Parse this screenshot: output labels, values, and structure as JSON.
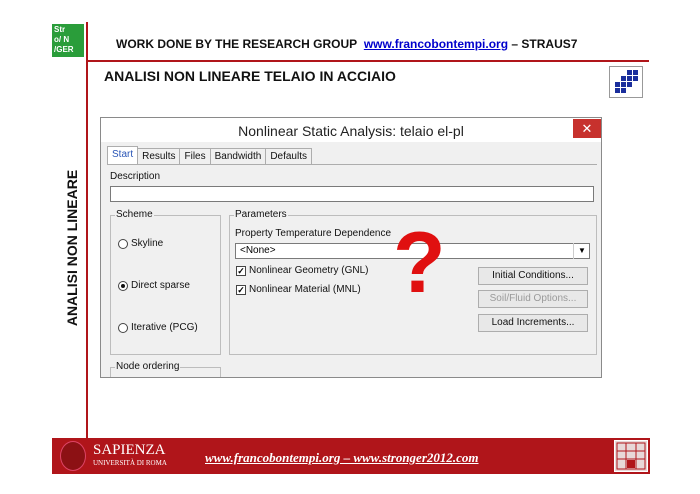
{
  "logo": {
    "line1": "Str",
    "line2": "o/ N",
    "line3": "/GER"
  },
  "header": {
    "prefix": "WORK DONE BY THE RESEARCH GROUP",
    "link": "www.francobontempi.org",
    "suffix": "– STRAUS7"
  },
  "subtitle": "ANALISI NON LINEARE TELAIO IN ACCIAIO",
  "side_label": "ANALISI NON LINEARE",
  "dialog": {
    "title": "Nonlinear Static Analysis: telaio el-pl",
    "close": "✕",
    "tabs": [
      "Start",
      "Results",
      "Files",
      "Bandwidth",
      "Defaults"
    ],
    "description_label": "Description",
    "description_value": "",
    "scheme": {
      "legend": "Scheme",
      "options": [
        "Skyline",
        "Direct sparse",
        "Iterative (PCG)"
      ],
      "selected": "Direct sparse"
    },
    "node_ordering_legend": "Node ordering",
    "parameters": {
      "legend": "Parameters",
      "ptd_label": "Property Temperature Dependence",
      "ptd_value": "<None>",
      "check_gnl": "Nonlinear Geometry (GNL)",
      "check_mnl": "Nonlinear Material (MNL)",
      "btn_initial": "Initial Conditions...",
      "btn_soil": "Soil/Fluid Options...",
      "btn_load": "Load Increments..."
    },
    "annotation": "?"
  },
  "footer": {
    "university": "SAPIENZA",
    "university_sub": "UNIVERSITÀ DI ROMA",
    "links": "www.francobontempi.org – www.stronger2012.com"
  }
}
